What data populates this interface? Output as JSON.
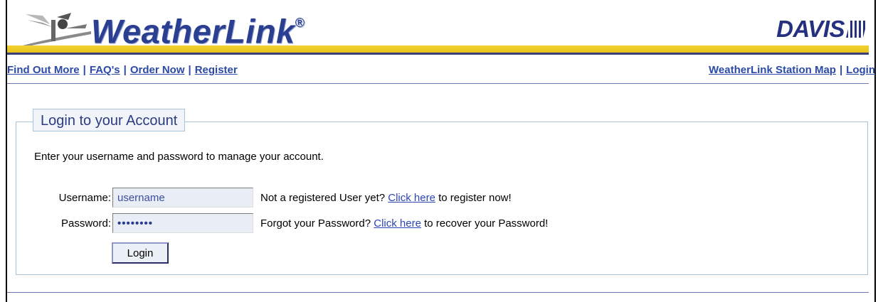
{
  "header": {
    "logo_text": "WeatherLink",
    "logo_mark": "®",
    "brand_text": "DAVIS",
    "logo_icon": "weather-station-icon"
  },
  "nav": {
    "left": [
      "Find Out More",
      "FAQ's",
      "Order Now",
      "Register"
    ],
    "right": [
      "WeatherLink Station Map",
      "Login"
    ],
    "separator": "|"
  },
  "login": {
    "legend": "Login to your Account",
    "intro": "Enter your username and password to manage your account.",
    "username_label": "Username:",
    "username_value": "username",
    "username_note_before": "Not a registered User yet?",
    "username_note_link": "Click here",
    "username_note_after": "to register now!",
    "password_label": "Password:",
    "password_value": "password",
    "password_note_before": "Forgot your Password?",
    "password_note_link": "Click here",
    "password_note_after": "to recover your Password!",
    "button_label": "Login"
  },
  "colors": {
    "brand_blue": "#2a3f90",
    "gold_bar": "#f2d233",
    "link": "#2b4aa8",
    "panel_border": "#a9c3d9"
  }
}
